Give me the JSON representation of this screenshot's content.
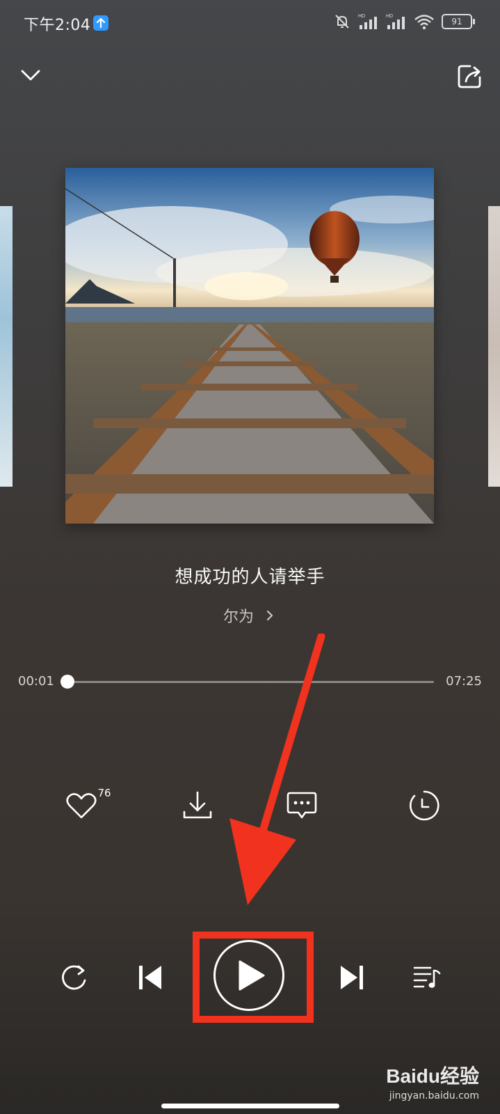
{
  "status_bar": {
    "time": "下午2:04",
    "battery": "91"
  },
  "song": {
    "title": "想成功的人请举手",
    "artist": "尔为"
  },
  "progress": {
    "elapsed": "00:01",
    "duration": "07:25",
    "fraction": 0.002
  },
  "actions": {
    "like_count": "76"
  },
  "watermark": {
    "brand": "Baidu经验",
    "url": "jingyan.baidu.com"
  },
  "icons": [
    "upload-badge-icon",
    "mute-icon",
    "signal-icon",
    "wifi-icon",
    "battery-icon",
    "chevron-down-icon",
    "share-icon",
    "heart-icon",
    "download-icon",
    "comment-icon",
    "timer-icon",
    "repeat-icon",
    "previous-icon",
    "play-icon",
    "next-icon",
    "playlist-icon",
    "arrow-annotation"
  ],
  "colors": {
    "annotation": "#f0321e",
    "accent_badge": "#2f9bff"
  }
}
